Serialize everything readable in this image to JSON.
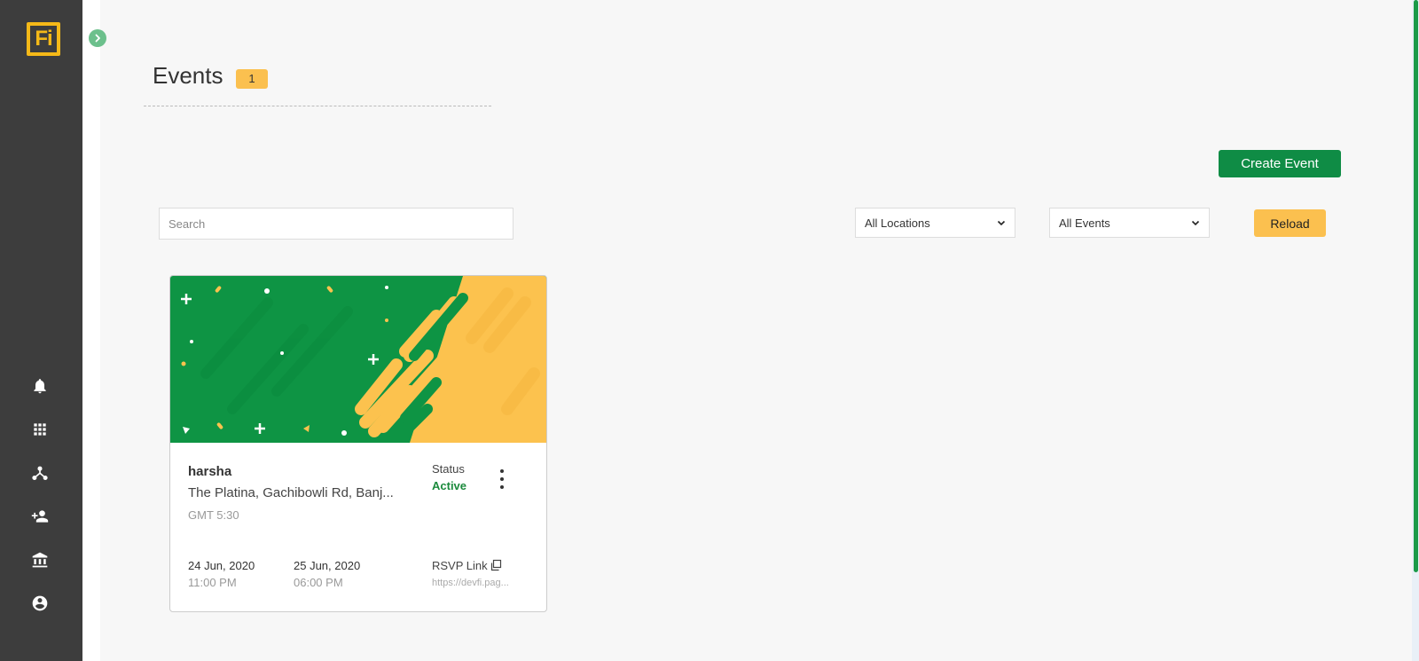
{
  "brand": {
    "logo_text": "Fi",
    "logo_color": "#f5b918"
  },
  "sidebar": {
    "items": [
      {
        "name": "notifications",
        "icon": "bell-icon"
      },
      {
        "name": "apps",
        "icon": "grid-icon"
      },
      {
        "name": "network",
        "icon": "hierarchy-icon"
      },
      {
        "name": "add-user",
        "icon": "person-add-icon"
      },
      {
        "name": "institution",
        "icon": "bank-icon"
      },
      {
        "name": "account",
        "icon": "account-circle-icon"
      }
    ]
  },
  "header": {
    "title": "Events",
    "count": "1"
  },
  "toolbar": {
    "create_label": "Create Event",
    "search_placeholder": "Search",
    "location_filter": "All Locations",
    "event_filter": "All Events",
    "reload_label": "Reload"
  },
  "events": [
    {
      "name": "harsha",
      "location": "The Platina, Gachibowli Rd, Banj...",
      "timezone": "GMT 5:30",
      "status_label": "Status",
      "status": "Active",
      "start_date": "24 Jun, 2020",
      "start_time": "11:00 PM",
      "end_date": "25 Jun, 2020",
      "end_time": "06:00 PM",
      "rsvp_label": "RSVP Link",
      "rsvp_url": "https://devfi.pag..."
    }
  ],
  "colors": {
    "sidebar_bg": "#3d3d3d",
    "primary_green": "#0f8c45",
    "accent_yellow": "#fbc04f",
    "status_active": "#1b8a3c"
  }
}
